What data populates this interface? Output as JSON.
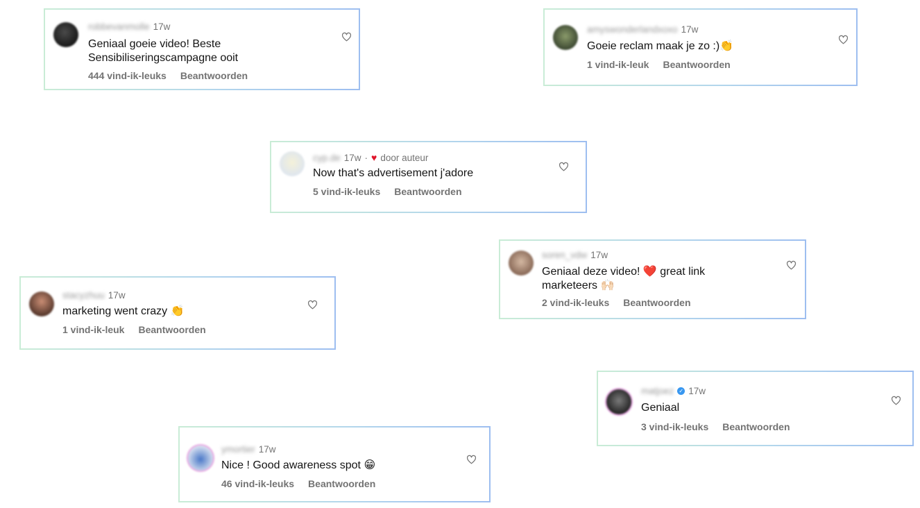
{
  "labels": {
    "reply": "Beantwoorden",
    "author_liked": "door auteur",
    "separator": "·"
  },
  "colors": {
    "heart": "#e0162b",
    "verified": "#3897f0",
    "meta": "#737373"
  },
  "comments": [
    {
      "username": "robbevanmolle",
      "time": "17w",
      "text": "Geniaal goeie video! Beste Sensibiliseringscampagne ooit",
      "likes": "444 vind-ik-leuks"
    },
    {
      "username": "amyswonderlandxoxo",
      "time": "17w",
      "text": "Goeie reclam maak je zo :)👏",
      "likes": "1 vind-ik-leuk"
    },
    {
      "username": "cyp.de",
      "time": "17w",
      "text": "Now that's advertisement j'adore",
      "likes": "5 vind-ik-leuks"
    },
    {
      "username": "soren_vdw",
      "time": "17w",
      "text": "Geniaal deze video! ❤️ great link marketeers 🙌🏻",
      "likes": "2 vind-ik-leuks"
    },
    {
      "username": "stacyzhuu",
      "time": "17w",
      "text": "marketing went crazy 👏",
      "likes": "1 vind-ik-leuk"
    },
    {
      "username": "matjoez",
      "time": "17w",
      "text": "Geniaal",
      "likes": "3 vind-ik-leuks"
    },
    {
      "username": "ymortier",
      "time": "17w",
      "text": "Nice ! Good awareness spot 😁",
      "likes": "46 vind-ik-leuks"
    }
  ]
}
